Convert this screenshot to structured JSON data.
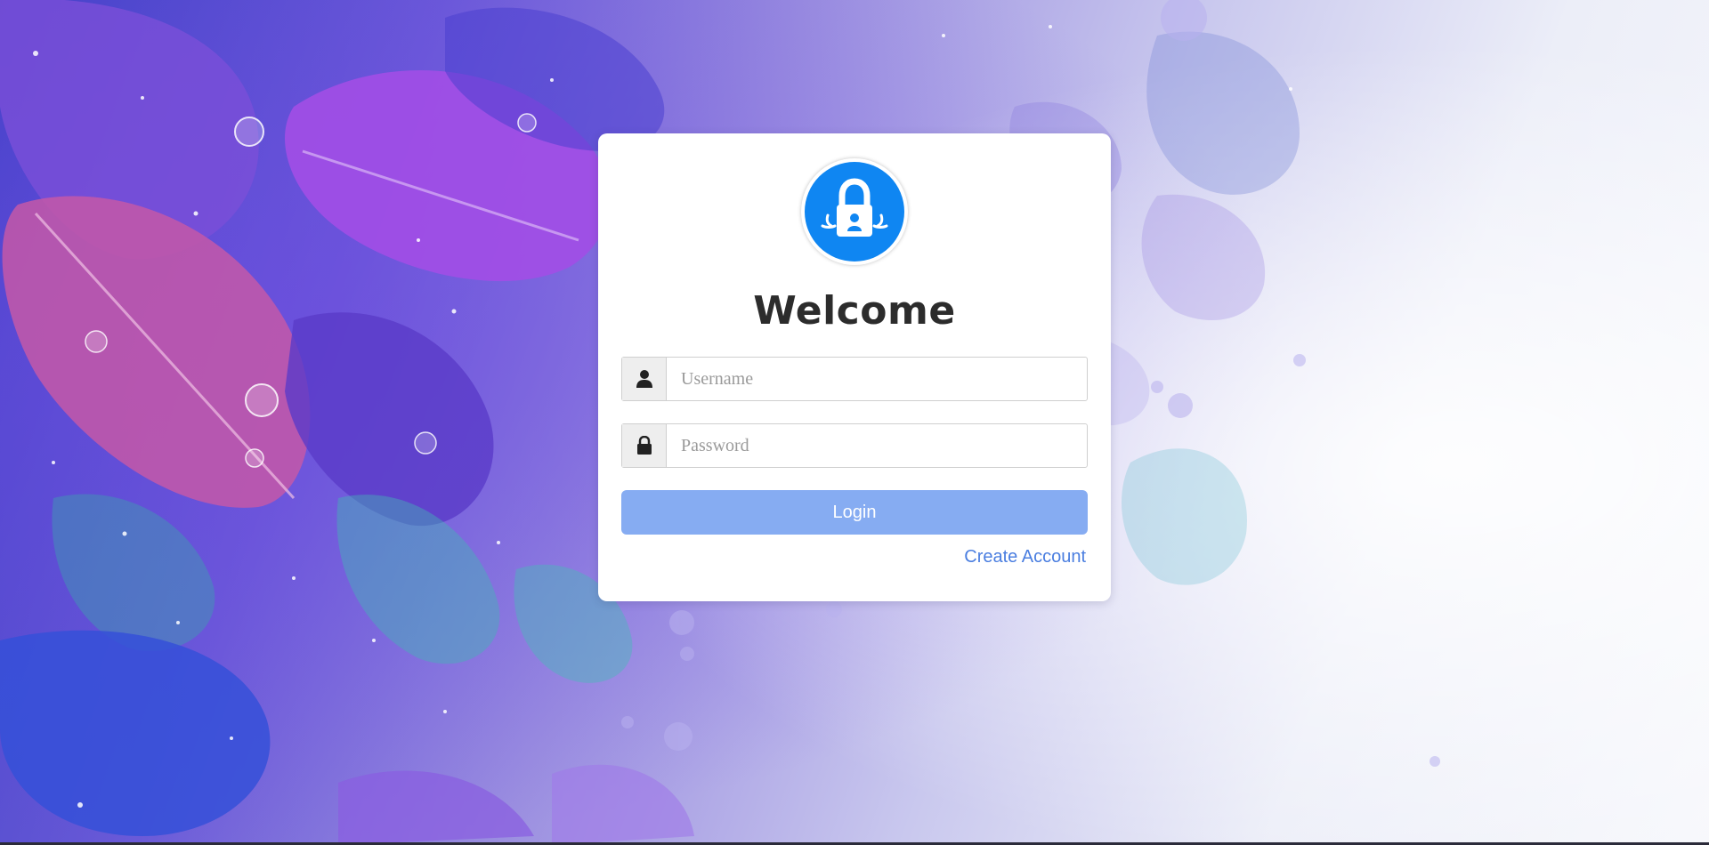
{
  "login": {
    "title": "Welcome",
    "username_placeholder": "Username",
    "password_placeholder": "Password",
    "login_label": "Login",
    "create_account_label": "Create Account",
    "logo_icon": "padlock-icon",
    "username_icon": "user-icon",
    "password_icon": "lock-icon"
  },
  "colors": {
    "logo_blue": "#0f86f2",
    "login_button": "#86acf2",
    "link": "#4a7ee0",
    "title_text": "#2c2c2c"
  }
}
